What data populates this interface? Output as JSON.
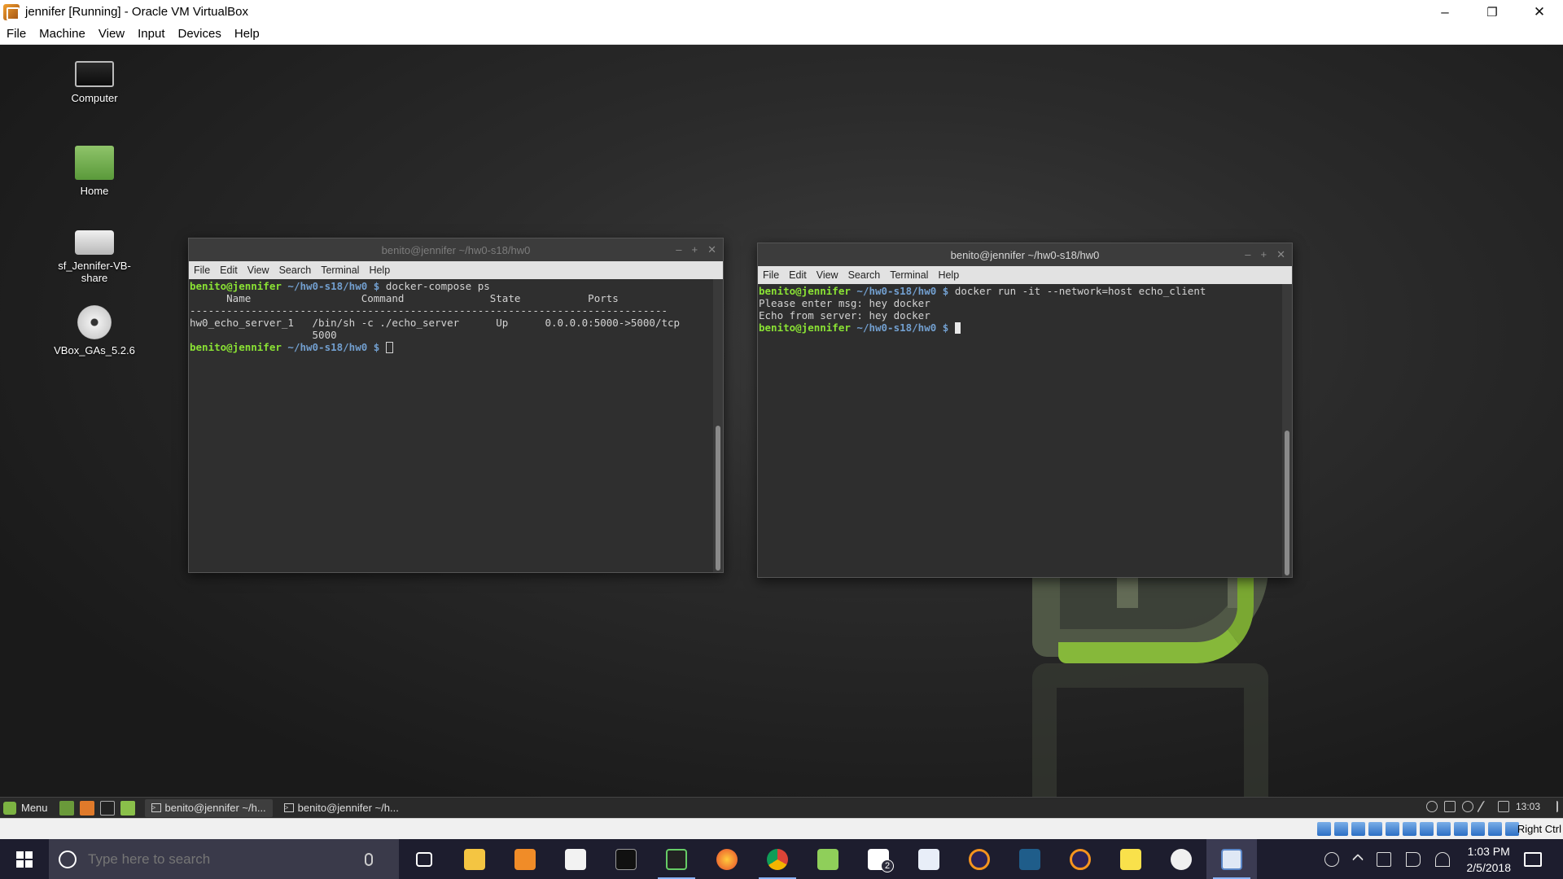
{
  "vbox": {
    "title": "jennifer [Running] - Oracle VM VirtualBox",
    "menu": [
      "File",
      "Machine",
      "View",
      "Input",
      "Devices",
      "Help"
    ],
    "controls": {
      "minimize": "–",
      "restore": "❐",
      "close": "✕"
    },
    "host_key": "Right Ctrl"
  },
  "desktop": {
    "icons": [
      {
        "label": "Computer",
        "icon": "computer-icon"
      },
      {
        "label": "Home",
        "icon": "home-folder-icon"
      },
      {
        "label": "sf_Jennifer-VB-share",
        "icon": "drive-icon"
      },
      {
        "label": "VBox_GAs_5.2.6",
        "icon": "cd-icon"
      }
    ]
  },
  "terminal_left": {
    "title": "benito@jennifer ~/hw0-s18/hw0",
    "menu": [
      "File",
      "Edit",
      "View",
      "Search",
      "Terminal",
      "Help"
    ],
    "lines": [
      {
        "user": "benito@jennifer",
        "path": " ~/hw0-s18/hw0 $",
        "cmd": " docker-compose ps"
      },
      {
        "text": "      Name                  Command              State           Ports"
      },
      {
        "text": "------------------------------------------------------------------------------"
      },
      {
        "text": "hw0_echo_server_1   /bin/sh -c ./echo_server      Up      0.0.0.0:5000->5000/tcp"
      },
      {
        "text": "                    5000"
      },
      {
        "user": "benito@jennifer",
        "path": " ~/hw0-s18/hw0 $",
        "cmd": " "
      }
    ]
  },
  "terminal_right": {
    "title": "benito@jennifer ~/hw0-s18/hw0",
    "menu": [
      "File",
      "Edit",
      "View",
      "Search",
      "Terminal",
      "Help"
    ],
    "lines": [
      {
        "user": "benito@jennifer",
        "path": " ~/hw0-s18/hw0 $",
        "cmd": " docker run -it --network=host echo_client"
      },
      {
        "text": "Please enter msg: hey docker"
      },
      {
        "text": "Echo from server: hey docker"
      },
      {
        "user": "benito@jennifer",
        "path": " ~/hw0-s18/hw0 $",
        "cmd": " "
      }
    ]
  },
  "mint_panel": {
    "menu_label": "Menu",
    "tasks": [
      "benito@jennifer ~/h...",
      "benito@jennifer ~/h..."
    ],
    "clock": "13:03"
  },
  "windows_taskbar": {
    "search_placeholder": "Type here to search",
    "mail_badge": "2",
    "time": "1:03 PM",
    "date": "2/5/2018"
  },
  "colors": {
    "prompt_user": "#8ae234",
    "prompt_path": "#729fcf",
    "terminal_bg": "#2f2f2f",
    "mint_green": "#86b83a",
    "taskbar_bg": "#1d1d2e"
  }
}
